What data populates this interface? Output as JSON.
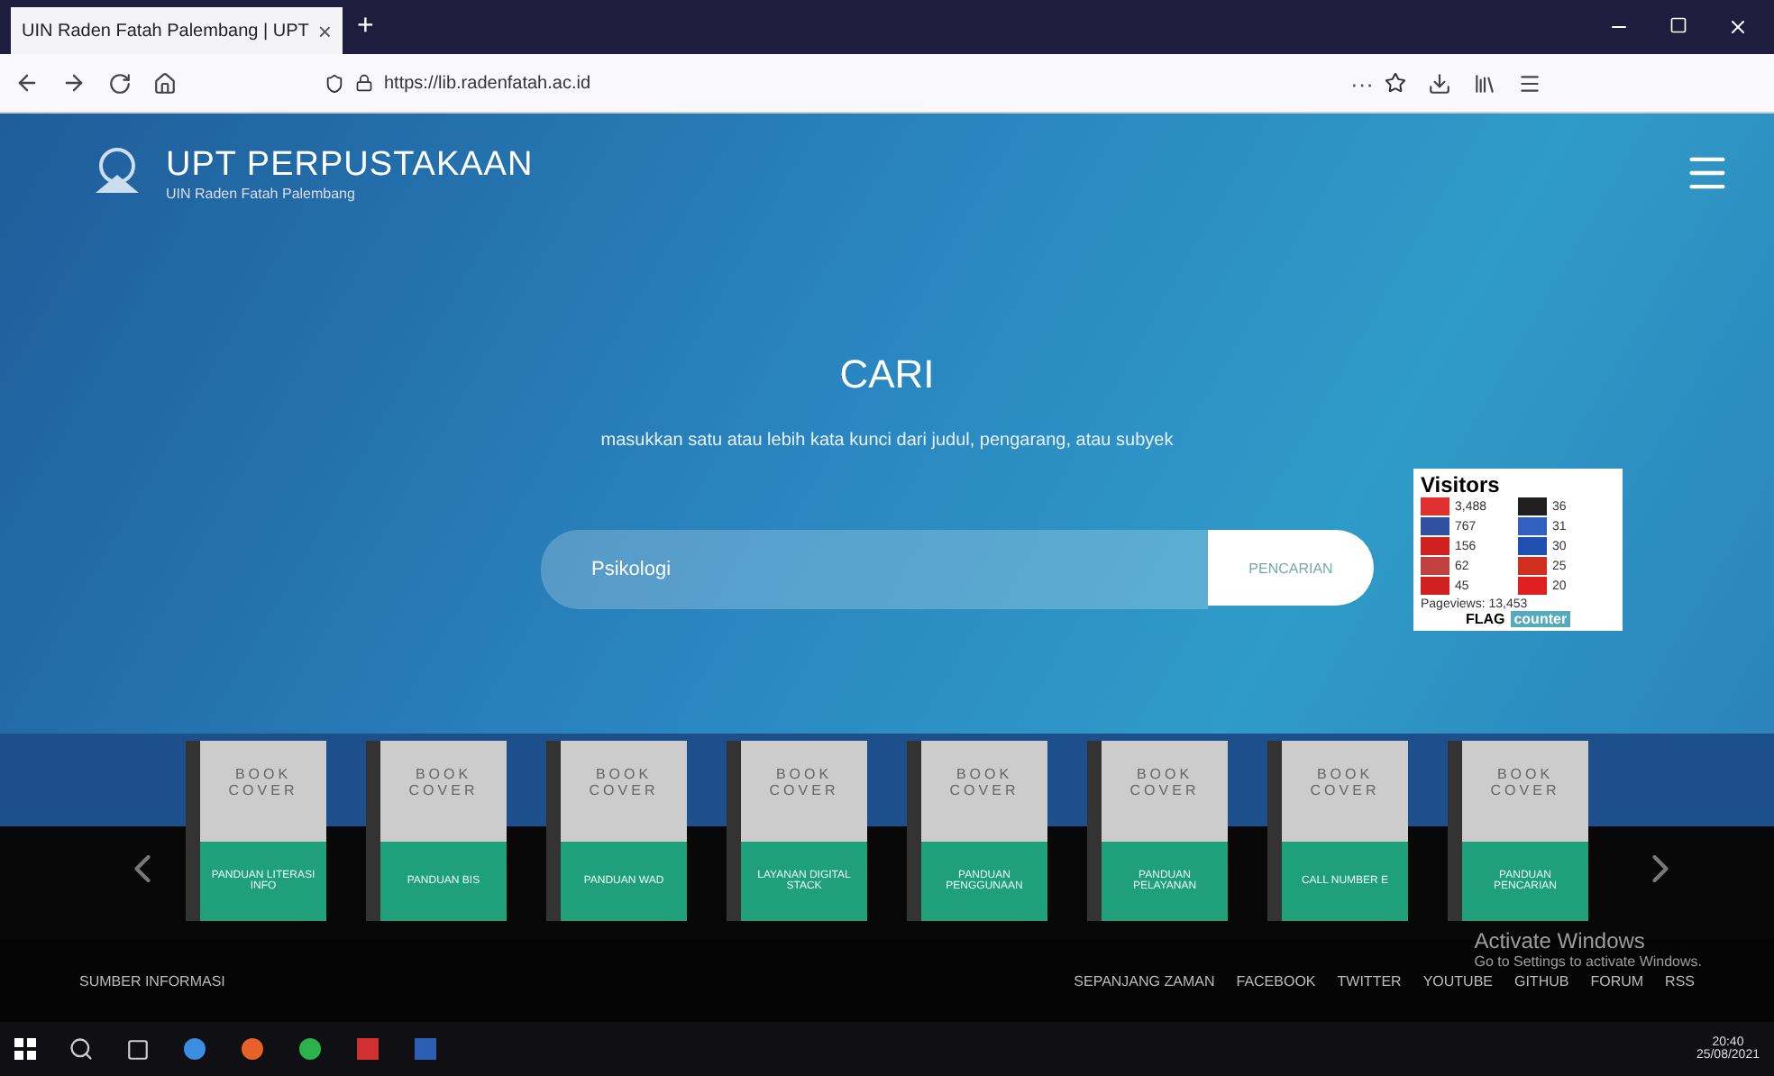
{
  "browser": {
    "tab_title": "UIN Raden Fatah Palembang | UPT",
    "tab_close": "×",
    "new_tab": "+",
    "url": "https://lib.radenfatah.ac.id",
    "page_actions": "···"
  },
  "header": {
    "title": "UPT PERPUSTAKAAN",
    "subtitle": "UIN Raden Fatah Palembang"
  },
  "search": {
    "heading": "CARI",
    "hint": "masukkan satu atau lebih kata kunci dari judul, pengarang, atau subyek",
    "value": "Psikologi",
    "button": "PENCARIAN"
  },
  "visitors": {
    "title": "Visitors",
    "entries": [
      {
        "count": "3,488",
        "color": "#e03030"
      },
      {
        "count": "767",
        "color": "#3050a0"
      },
      {
        "count": "156",
        "color": "#d02020"
      },
      {
        "count": "62",
        "color": "#c04040"
      },
      {
        "count": "45",
        "color": "#d02020"
      },
      {
        "count": "36",
        "color": "#202020"
      },
      {
        "count": "31",
        "color": "#3060c0"
      },
      {
        "count": "30",
        "color": "#2050b0"
      },
      {
        "count": "25",
        "color": "#d03020"
      },
      {
        "count": "20",
        "color": "#e02020"
      }
    ],
    "pageviews": "Pageviews: 13,453",
    "brand_a": "FLAG",
    "brand_b": "counter"
  },
  "books": [
    {
      "cover": "BOOK COVER",
      "label": "PANDUAN LITERASI INFO"
    },
    {
      "cover": "BOOK COVER",
      "label": "PANDUAN BIS"
    },
    {
      "cover": "BOOK COVER",
      "label": "PANDUAN WAD"
    },
    {
      "cover": "BOOK COVER",
      "label": "LAYANAN DIGITAL STACK"
    },
    {
      "cover": "BOOK COVER",
      "label": "PANDUAN PENGGUNAAN"
    },
    {
      "cover": "BOOK COVER",
      "label": "PANDUAN PELAYANAN"
    },
    {
      "cover": "BOOK COVER",
      "label": "CALL NUMBER E"
    },
    {
      "cover": "BOOK COVER",
      "label": "PANDUAN PENCARIAN"
    }
  ],
  "footer": {
    "left": "SUMBER INFORMASI",
    "links": [
      "SEPANJANG ZAMAN",
      "FACEBOOK",
      "TWITTER",
      "YOUTUBE",
      "GITHUB",
      "FORUM",
      "RSS"
    ]
  },
  "os_notice": {
    "title": "Activate Windows",
    "text": "Go to Settings to activate Windows."
  },
  "taskbar": {
    "time": "20:40",
    "date": "25/08/2021"
  }
}
